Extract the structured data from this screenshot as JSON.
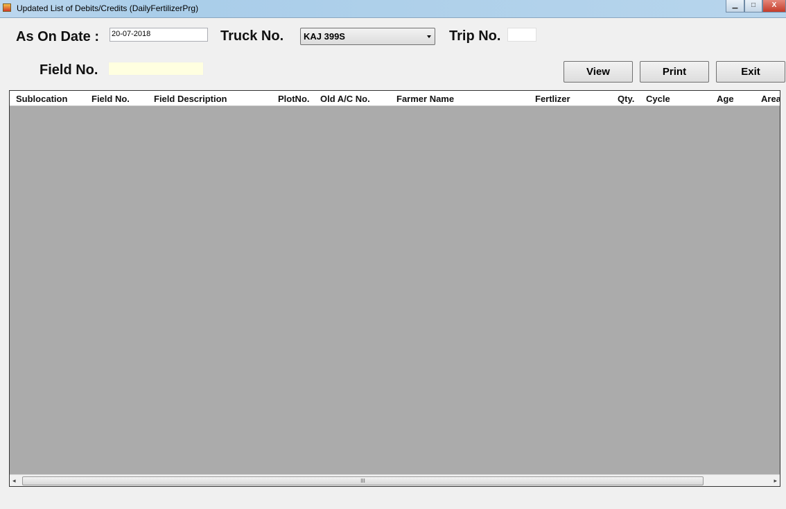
{
  "window": {
    "title": "Updated List of Debits/Credits (DailyFertilizerPrg)",
    "minimize": "▁",
    "maximize": "□",
    "close": "X"
  },
  "form": {
    "as_on_date_label": "As On Date :",
    "as_on_date_value": "20-07-2018",
    "truck_label": "Truck No.",
    "truck_value": "KAJ 399S",
    "trip_label": "Trip No.",
    "trip_value": "",
    "field_label": "Field No.",
    "field_value": ""
  },
  "buttons": {
    "view": "View",
    "print": "Print",
    "exit": "Exit"
  },
  "grid": {
    "columns": [
      "Sublocation",
      "Field No.",
      "Field Description",
      "PlotNo.",
      "Old A/C No.",
      "Farmer Name",
      "Fertlizer",
      "Qty.",
      "Cycle",
      "Age",
      "Area"
    ],
    "rows": []
  },
  "scrollbar": {
    "left": "◂",
    "right": "▸",
    "grip": "III"
  }
}
